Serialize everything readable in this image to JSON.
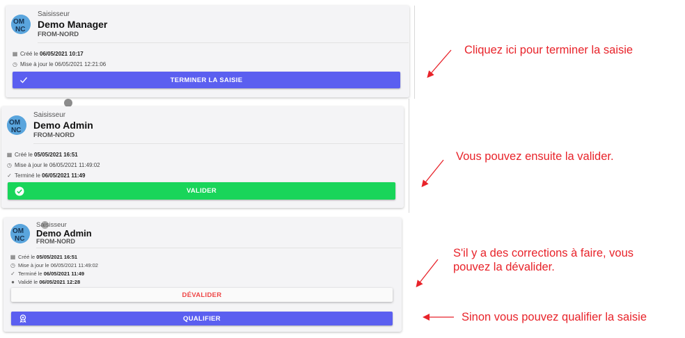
{
  "cards": [
    {
      "role": "Saisisseur",
      "name": "Demo Manager",
      "org": "FROM-NORD",
      "meta": [
        {
          "icon": "calendar-icon",
          "label": "Créé le",
          "value": "06/05/2021 10:17",
          "bold": true
        },
        {
          "icon": "clock-icon",
          "label": "Mise à jour le",
          "value": "06/05/2021 12:21:06",
          "bold": false
        }
      ],
      "button": {
        "label": "TERMINER LA SAISIE",
        "icon": "check-icon",
        "color": "#5b5ff0"
      }
    },
    {
      "role": "Saisisseur",
      "name": "Demo Admin",
      "org": "FROM-NORD",
      "meta": [
        {
          "icon": "calendar-icon",
          "label": "Créé le",
          "value": "05/05/2021 16:51",
          "bold": true
        },
        {
          "icon": "clock-icon",
          "label": "Mise à jour le",
          "value": "06/05/2021 11:49:02",
          "bold": false
        },
        {
          "icon": "check-icon",
          "label": "Terminé le",
          "value": "06/05/2021 11:49",
          "bold": true
        }
      ],
      "button": {
        "label": "VALIDER",
        "icon": "check-circle-icon",
        "color": "#19d55a"
      }
    },
    {
      "role": "Saisisseur",
      "name": "Demo Admin",
      "org": "FROM-NORD",
      "meta": [
        {
          "icon": "calendar-icon",
          "label": "Créé le",
          "value": "05/05/2021 16:51",
          "bold": true
        },
        {
          "icon": "clock-icon",
          "label": "Mise à jour le",
          "value": "06/05/2021 11:49:02",
          "bold": false
        },
        {
          "icon": "check-icon",
          "label": "Terminé le",
          "value": "06/05/2021 11:49",
          "bold": true
        },
        {
          "icon": "check-circle-icon",
          "label": "Validé le",
          "value": "06/05/2021 12:28",
          "bold": true
        }
      ],
      "buttons": [
        {
          "label": "DÉVALIDER",
          "color": "#ee4545"
        },
        {
          "label": "QUALIFIER",
          "icon": "award-icon",
          "color": "#5b5ff0"
        }
      ]
    }
  ],
  "annotations": {
    "terminer": "Cliquez ici pour terminer la saisie",
    "valider": "Vous pouvez ensuite la valider.",
    "devalider_line1": "S'il y a des corrections à faire, vous",
    "devalider_line2": "pouvez la dévalider.",
    "qualifier": "Sinon vous pouvez qualifier la saisie"
  },
  "colors": {
    "accent_blue": "#5b5ff0",
    "accent_green": "#19d55a",
    "danger_red": "#ee4545",
    "annotation_red": "#e8232a"
  }
}
